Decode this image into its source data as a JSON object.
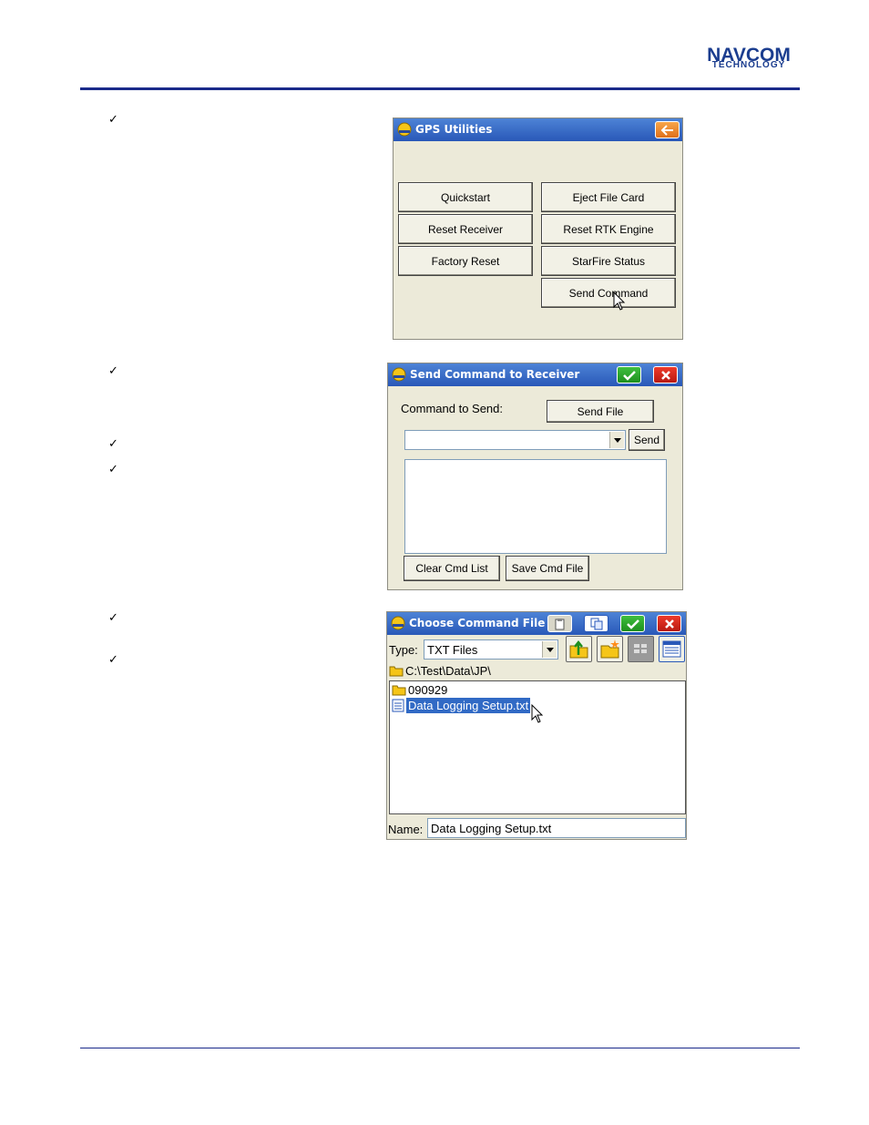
{
  "header": {
    "logo_main": "NAVCOM",
    "logo_sub": "TECHNOLOGY"
  },
  "check_mark": "✓",
  "gps_utilities": {
    "title": "GPS Utilities",
    "buttons_left": [
      "Quickstart",
      "Reset Receiver",
      "Factory Reset"
    ],
    "buttons_right": [
      "Eject File Card",
      "Reset RTK Engine",
      "StarFire Status",
      "Send Command"
    ]
  },
  "send_command": {
    "title": "Send Command to Receiver",
    "command_label": "Command to Send:",
    "send_file_label": "Send File",
    "command_value": "",
    "send_label": "Send",
    "clear_label": "Clear Cmd List",
    "save_label": "Save Cmd File"
  },
  "choose_file": {
    "title": "Choose Command File",
    "type_label": "Type:",
    "type_value": "TXT Files",
    "path": "C:\\Test\\Data\\JP\\",
    "items": [
      {
        "name": "090929",
        "kind": "folder"
      },
      {
        "name": "Data Logging Setup.txt",
        "kind": "file",
        "selected": true
      }
    ],
    "name_label": "Name:",
    "name_value": "Data Logging Setup.txt"
  },
  "colors": {
    "title_bar": "#2958b8",
    "window_bg": "#ecead9",
    "ok_green": "#1e8f1e",
    "cancel_red": "#b81a12",
    "brand_blue": "#1b3d8f",
    "selection": "#316ac5"
  }
}
